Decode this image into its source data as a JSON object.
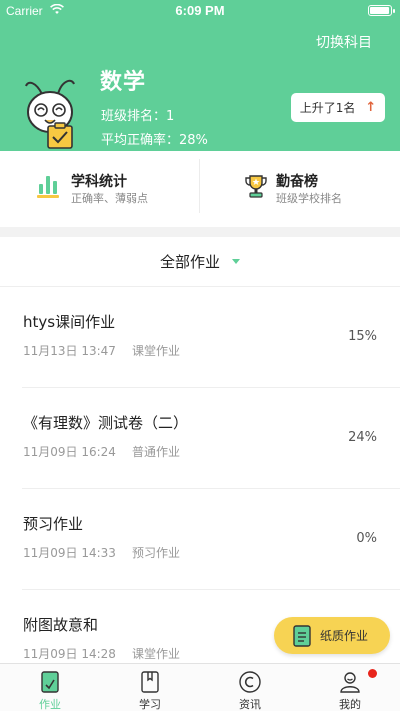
{
  "status_bar": {
    "carrier": "Carrier",
    "time": "6:09 PM"
  },
  "header": {
    "switch_subject": "切换科目",
    "subject": "数学",
    "class_rank": "班级排名：1",
    "avg_accuracy": "平均正确率：28%",
    "rank_change": "上升了1名",
    "rank_arrow": "↑",
    "bg_color": "#5fcf98"
  },
  "stats": {
    "subject_stats": {
      "title": "学科统计",
      "subtitle": "正确率、薄弱点",
      "icon": "bar-chart-icon"
    },
    "diligence_board": {
      "title": "勤奋榜",
      "subtitle": "班级学校排名",
      "icon": "trophy-icon"
    }
  },
  "filter": {
    "label": "全部作业"
  },
  "assignments": [
    {
      "title": "htys课间作业",
      "date": "11月13日 13:47",
      "type": "课堂作业",
      "percent": "15%"
    },
    {
      "title": "《有理数》测试卷（二）",
      "date": "11月09日 16:24",
      "type": "普通作业",
      "percent": "24%"
    },
    {
      "title": "预习作业",
      "date": "11月09日 14:33",
      "type": "预习作业",
      "percent": "0%"
    },
    {
      "title": "附图故意和",
      "date": "11月09日 14:28",
      "type": "课堂作业",
      "percent": ""
    }
  ],
  "paper_button": {
    "label": "纸质作业",
    "icon": "paper-icon"
  },
  "tabs": [
    {
      "label": "作业",
      "icon": "homework-icon",
      "active": true
    },
    {
      "label": "学习",
      "icon": "book-icon",
      "active": false
    },
    {
      "label": "资讯",
      "icon": "news-icon",
      "active": false
    },
    {
      "label": "我的",
      "icon": "profile-icon",
      "active": false
    }
  ],
  "accent_color": "#5fcf98",
  "badge_color": "#e8251c"
}
